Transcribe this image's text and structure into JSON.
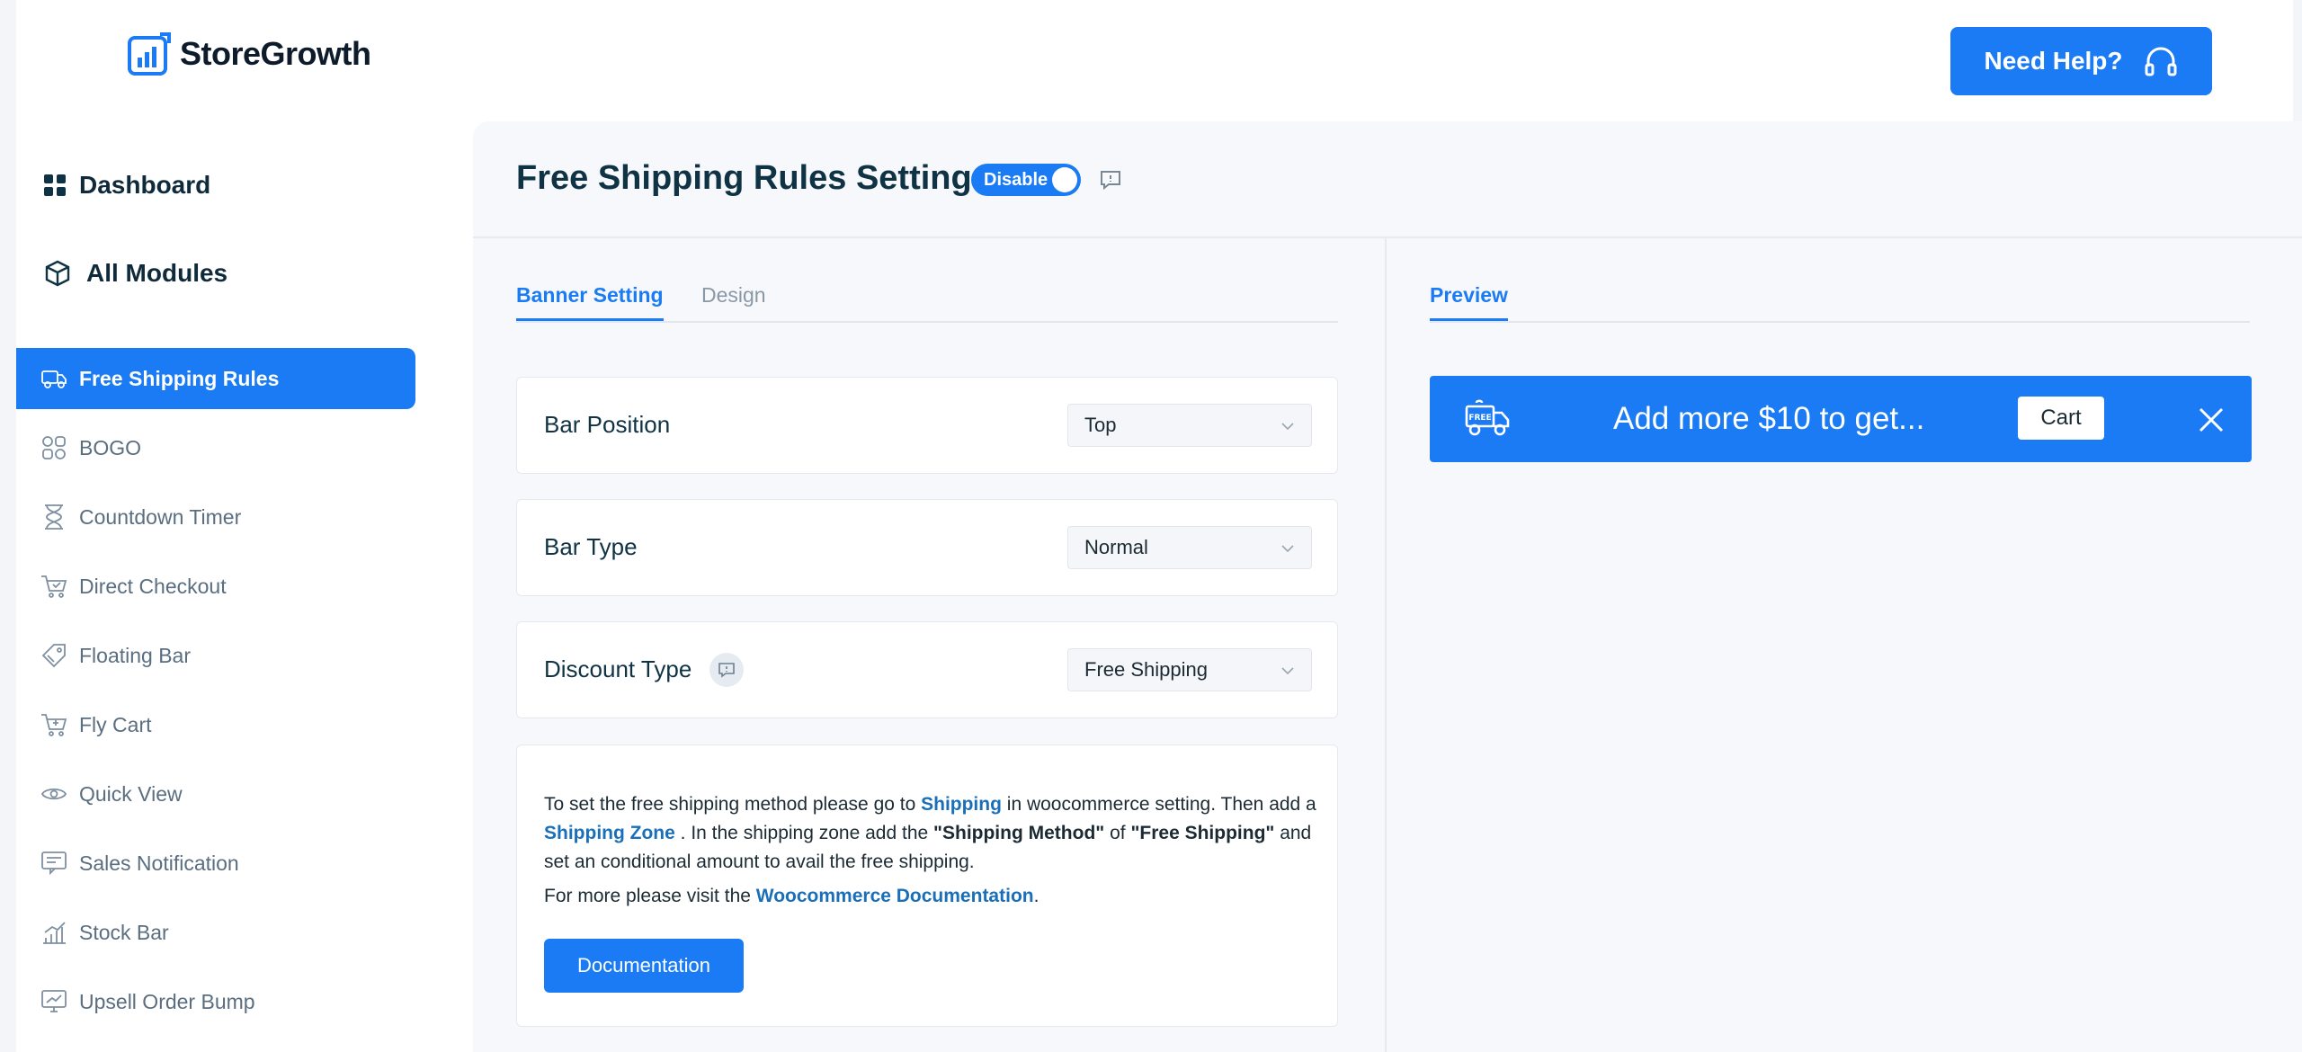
{
  "brand": {
    "name": "StoreGrowth"
  },
  "header": {
    "help_label": "Need Help?"
  },
  "sidebar": {
    "dashboard": "Dashboard",
    "all_modules": "All Modules",
    "items": [
      {
        "label": "Free Shipping Rules",
        "icon": "truck-icon"
      },
      {
        "label": "BOGO",
        "icon": "bogo-icon"
      },
      {
        "label": "Countdown Timer",
        "icon": "hourglass-icon"
      },
      {
        "label": "Direct Checkout",
        "icon": "checkout-cart-icon"
      },
      {
        "label": "Floating Bar",
        "icon": "tag-icon"
      },
      {
        "label": "Fly Cart",
        "icon": "cart-icon"
      },
      {
        "label": "Quick View",
        "icon": "eye-icon"
      },
      {
        "label": "Sales Notification",
        "icon": "notification-icon"
      },
      {
        "label": "Stock Bar",
        "icon": "bar-chart-icon"
      },
      {
        "label": "Upsell Order Bump",
        "icon": "monitor-chart-icon"
      }
    ],
    "active_index": 0
  },
  "page": {
    "title": "Free Shipping Rules Setting",
    "toggle_label": "Disable",
    "tabs": [
      "Banner Setting",
      "Design"
    ],
    "preview_tab": "Preview"
  },
  "settings": {
    "bar_position": {
      "label": "Bar Position",
      "value": "Top"
    },
    "bar_type": {
      "label": "Bar Type",
      "value": "Normal"
    },
    "discount_type": {
      "label": "Discount Type",
      "value": "Free Shipping"
    }
  },
  "note": {
    "p1_a": "To set the free shipping method please go to ",
    "p1_link1": "Shipping",
    "p1_b": " in woocommerce setting. Then add a ",
    "p1_link2": "Shipping Zone",
    "p1_c": " . In the shipping zone add the ",
    "p1_bold1": "\"Shipping Method\"",
    "p1_d": " of ",
    "p1_bold2": "\"Free Shipping\"",
    "p1_e": " and set an conditional amount to avail the free shipping.",
    "p2_a": "For more please visit the ",
    "p2_link": "Woocommerce Documentation",
    "p2_b": ".",
    "button": "Documentation"
  },
  "preview": {
    "badge": "FREE",
    "message": "Add more $10 to get...",
    "cart_button": "Cart"
  },
  "colors": {
    "accent": "#1a7bf4",
    "heading": "#0f3344",
    "link": "#1a6fb8"
  }
}
